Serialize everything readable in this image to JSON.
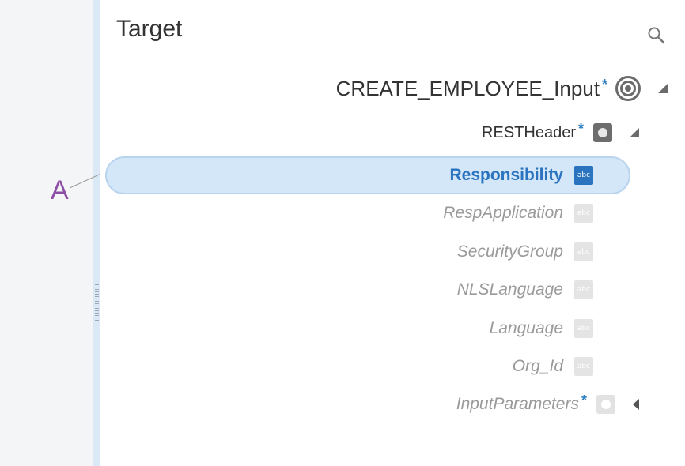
{
  "panel": {
    "title": "Target"
  },
  "tree": {
    "root": {
      "label": "CREATE_EMPLOYEE_Input",
      "required_mark": "*"
    },
    "header": {
      "label": "RESTHeader",
      "required_mark": "*"
    },
    "fields": [
      {
        "label": "Responsibility",
        "type_icon": "abc",
        "selected": true
      },
      {
        "label": "RespApplication",
        "type_icon": "abc"
      },
      {
        "label": "SecurityGroup",
        "type_icon": "abc"
      },
      {
        "label": "NLSLanguage",
        "type_icon": "abc"
      },
      {
        "label": "Language",
        "type_icon": "abc"
      },
      {
        "label": "Org_Id",
        "type_icon": "abc"
      }
    ],
    "params": {
      "label": "InputParameters",
      "required_mark": "*"
    }
  },
  "callout": {
    "label": "A"
  },
  "colors": {
    "selection": "#d4e7f8",
    "accent": "#2a73bf",
    "callout": "#8e4ea6"
  }
}
